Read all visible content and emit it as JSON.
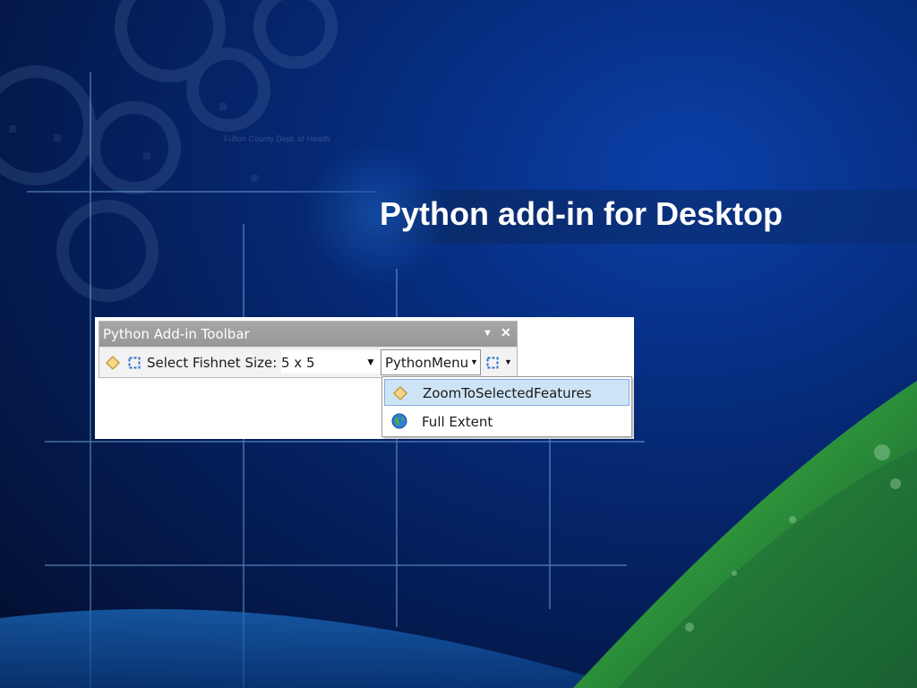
{
  "slide": {
    "title": "Python add-in for Desktop"
  },
  "toolbar": {
    "title": "Python Add-in Toolbar",
    "fishnet_label": "Select Fishnet Size:",
    "fishnet_value": "5 x 5",
    "menu_label": "PythonMenu"
  },
  "menu": {
    "items": [
      {
        "label": "ZoomToSelectedFeatures",
        "icon": "diamond-icon",
        "highlighted": true
      },
      {
        "label": "Full Extent",
        "icon": "globe-icon",
        "highlighted": false
      }
    ]
  },
  "colors": {
    "background": "#062a78",
    "title_text": "#ffffff",
    "toolbar_titlebar": "#a0a0a0",
    "menu_highlight": "#cde4f7",
    "menu_highlight_border": "#84acdd",
    "accent_green": "#3fb83a"
  }
}
